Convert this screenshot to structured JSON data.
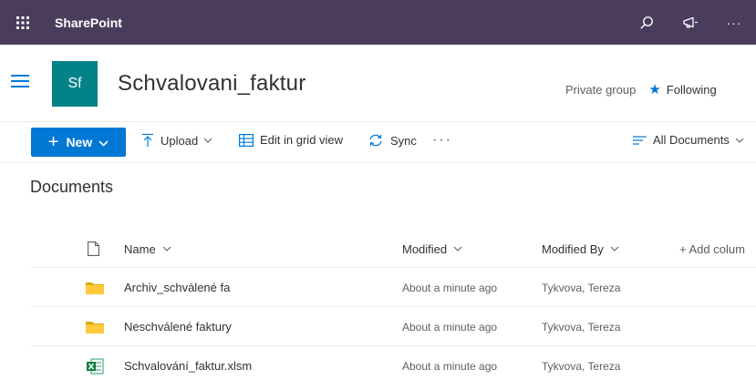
{
  "suitebar": {
    "brand": "SharePoint",
    "more": "···",
    "bg_color": "#4a3d5c"
  },
  "site": {
    "logo_text": "Sf",
    "logo_color": "#038387",
    "title": "Schvalovani_faktur",
    "privacy": "Private group",
    "follow_label": "Following"
  },
  "commandbar": {
    "new_label": "New",
    "upload_label": "Upload",
    "grid_label": "Edit in grid view",
    "sync_label": "Sync",
    "more": "···",
    "view_label": "All Documents"
  },
  "library": {
    "heading": "Documents",
    "columns": {
      "name": "Name",
      "modified": "Modified",
      "modified_by": "Modified By",
      "add_column": "+ Add colum"
    },
    "rows": [
      {
        "type": "folder",
        "name": "Archiv_schválené fa",
        "modified": "About a minute ago",
        "modified_by": "Tykvova, Tereza"
      },
      {
        "type": "folder",
        "name": "Neschválené faktury",
        "modified": "About a minute ago",
        "modified_by": "Tykvova, Tereza"
      },
      {
        "type": "excel",
        "name": "Schvalování_faktur.xlsm",
        "modified": "About a minute ago",
        "modified_by": "Tykvova, Tereza"
      }
    ]
  }
}
